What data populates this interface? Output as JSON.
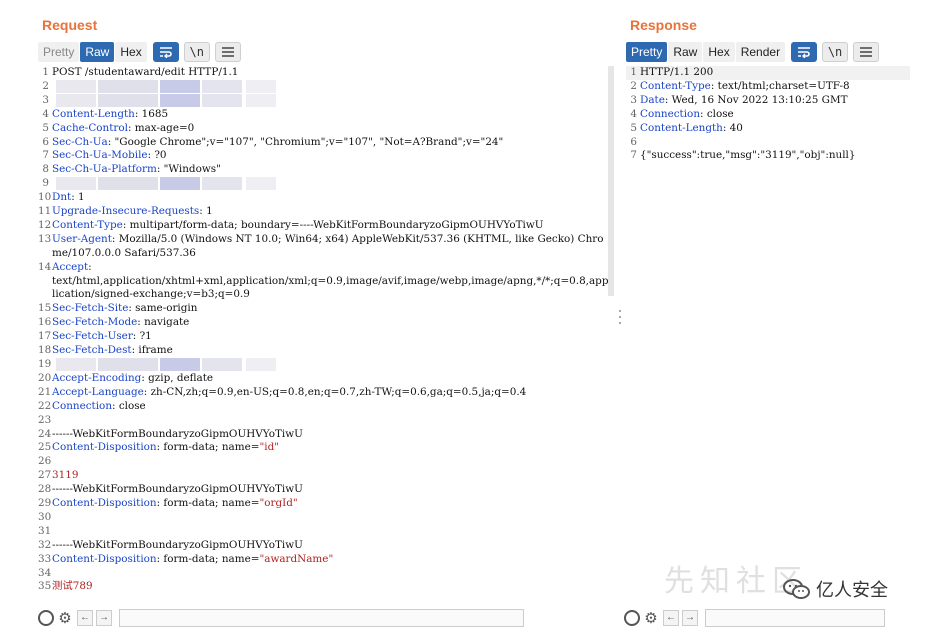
{
  "request": {
    "title": "Request",
    "tabs": [
      "Pretty",
      "Raw",
      "Hex"
    ],
    "newline_label": "\\n",
    "lines": [
      {
        "n": "1",
        "segs": [
          {
            "t": "POST /studentaward/edit HTTP/1.1",
            "c": "hv"
          }
        ]
      },
      {
        "n": "2",
        "segs": [],
        "blur": true
      },
      {
        "n": "3",
        "segs": [],
        "blur": true
      },
      {
        "n": "4",
        "segs": [
          {
            "t": "Content-Length",
            "c": "hk"
          },
          {
            "t": ": 1685",
            "c": "hv"
          }
        ]
      },
      {
        "n": "5",
        "segs": [
          {
            "t": "Cache-Control",
            "c": "hk"
          },
          {
            "t": ": max-age=0",
            "c": "hv"
          }
        ]
      },
      {
        "n": "6",
        "segs": [
          {
            "t": "Sec-Ch-Ua",
            "c": "hk"
          },
          {
            "t": ": \"Google Chrome\";v=\"107\", \"Chromium\";v=\"107\", \"Not=A?Brand\";v=\"24\"",
            "c": "hv"
          }
        ]
      },
      {
        "n": "7",
        "segs": [
          {
            "t": "Sec-Ch-Ua-Mobile",
            "c": "hk"
          },
          {
            "t": ": ?0",
            "c": "hv"
          }
        ]
      },
      {
        "n": "8",
        "segs": [
          {
            "t": "Sec-Ch-Ua-Platform",
            "c": "hk"
          },
          {
            "t": ": \"Windows\"",
            "c": "hv"
          }
        ]
      },
      {
        "n": "9",
        "segs": [],
        "blur": true
      },
      {
        "n": "10",
        "segs": [
          {
            "t": "Dnt",
            "c": "hk"
          },
          {
            "t": ": 1",
            "c": "hv"
          }
        ]
      },
      {
        "n": "11",
        "segs": [
          {
            "t": "Upgrade-Insecure-Requests",
            "c": "hk"
          },
          {
            "t": ": 1",
            "c": "hv"
          }
        ]
      },
      {
        "n": "12",
        "segs": [
          {
            "t": "Content-Type",
            "c": "hk"
          },
          {
            "t": ": multipart/form-data; boundary=----WebKitFormBoundaryzoGipmOUHVYoTiwU",
            "c": "hv"
          }
        ]
      },
      {
        "n": "13",
        "wrap": true,
        "segs": [
          {
            "t": "User-Agent",
            "c": "hk"
          },
          {
            "t": ": Mozilla/5.0 (Windows NT 10.0; Win64; x64) AppleWebKit/537.36 (KHTML, like Gecko) Chrome/107.0.0.0 Safari/537.36",
            "c": "hv"
          }
        ]
      },
      {
        "n": "14",
        "wrap": true,
        "segs": [
          {
            "t": "Accept",
            "c": "hk"
          },
          {
            "t": ":\ntext/html,application/xhtml+xml,application/xml;q=0.9,image/avif,image/webp,image/apng,*/*;q=0.8,application/signed-exchange;v=b3;q=0.9",
            "c": "hv"
          }
        ]
      },
      {
        "n": "15",
        "segs": [
          {
            "t": "Sec-Fetch-Site",
            "c": "hk"
          },
          {
            "t": ": same-origin",
            "c": "hv"
          }
        ]
      },
      {
        "n": "16",
        "segs": [
          {
            "t": "Sec-Fetch-Mode",
            "c": "hk"
          },
          {
            "t": ": navigate",
            "c": "hv"
          }
        ]
      },
      {
        "n": "17",
        "segs": [
          {
            "t": "Sec-Fetch-User",
            "c": "hk"
          },
          {
            "t": ": ?1",
            "c": "hv"
          }
        ]
      },
      {
        "n": "18",
        "segs": [
          {
            "t": "Sec-Fetch-Dest",
            "c": "hk"
          },
          {
            "t": ": iframe",
            "c": "hv"
          }
        ]
      },
      {
        "n": "19",
        "segs": [],
        "blur": true
      },
      {
        "n": "20",
        "segs": [
          {
            "t": "Accept-Encoding",
            "c": "hk"
          },
          {
            "t": ": gzip, deflate",
            "c": "hv"
          }
        ]
      },
      {
        "n": "21",
        "segs": [
          {
            "t": "Accept-Language",
            "c": "hk"
          },
          {
            "t": ": zh-CN,zh;q=0.9,en-US;q=0.8,en;q=0.7,zh-TW;q=0.6,ga;q=0.5,ja;q=0.4",
            "c": "hv"
          }
        ]
      },
      {
        "n": "22",
        "segs": [
          {
            "t": "Connection",
            "c": "hk"
          },
          {
            "t": ": close",
            "c": "hv"
          }
        ]
      },
      {
        "n": "23",
        "segs": []
      },
      {
        "n": "24",
        "segs": [
          {
            "t": "------WebKitFormBoundaryzoGipmOUHVYoTiwU",
            "c": "hv"
          }
        ]
      },
      {
        "n": "25",
        "segs": [
          {
            "t": "Content-Disposition",
            "c": "hk"
          },
          {
            "t": ": form-data; name=",
            "c": "hv"
          },
          {
            "t": "\"id\"",
            "c": "str"
          }
        ]
      },
      {
        "n": "26",
        "segs": []
      },
      {
        "n": "27",
        "segs": [
          {
            "t": "3119",
            "c": "str"
          }
        ]
      },
      {
        "n": "28",
        "segs": [
          {
            "t": "------WebKitFormBoundaryzoGipmOUHVYoTiwU",
            "c": "hv"
          }
        ]
      },
      {
        "n": "29",
        "segs": [
          {
            "t": "Content-Disposition",
            "c": "hk"
          },
          {
            "t": ": form-data; name=",
            "c": "hv"
          },
          {
            "t": "\"orgId\"",
            "c": "str"
          }
        ]
      },
      {
        "n": "30",
        "segs": []
      },
      {
        "n": "31",
        "segs": []
      },
      {
        "n": "32",
        "segs": [
          {
            "t": "------WebKitFormBoundaryzoGipmOUHVYoTiwU",
            "c": "hv"
          }
        ]
      },
      {
        "n": "33",
        "segs": [
          {
            "t": "Content-Disposition",
            "c": "hk"
          },
          {
            "t": ": form-data; name=",
            "c": "hv"
          },
          {
            "t": "\"awardName\"",
            "c": "str"
          }
        ]
      },
      {
        "n": "34",
        "segs": []
      },
      {
        "n": "35",
        "segs": [
          {
            "t": "测试789",
            "c": "str"
          }
        ]
      }
    ]
  },
  "response": {
    "title": "Response",
    "tabs": [
      "Pretty",
      "Raw",
      "Hex",
      "Render"
    ],
    "newline_label": "\\n",
    "lines": [
      {
        "n": "1",
        "hl": true,
        "segs": [
          {
            "t": "HTTP/1.1 200",
            "c": "hv"
          }
        ]
      },
      {
        "n": "2",
        "segs": [
          {
            "t": "Content-Type",
            "c": "hk"
          },
          {
            "t": ": text/html;charset=UTF-8",
            "c": "hv"
          }
        ]
      },
      {
        "n": "3",
        "segs": [
          {
            "t": "Date",
            "c": "hk"
          },
          {
            "t": ": Wed, 16 Nov 2022 13:10:25 GMT",
            "c": "hv"
          }
        ]
      },
      {
        "n": "4",
        "segs": [
          {
            "t": "Connection",
            "c": "hk"
          },
          {
            "t": ": close",
            "c": "hv"
          }
        ]
      },
      {
        "n": "5",
        "segs": [
          {
            "t": "Content-Length",
            "c": "hk"
          },
          {
            "t": ": 40",
            "c": "hv"
          }
        ]
      },
      {
        "n": "6",
        "segs": []
      },
      {
        "n": "7",
        "segs": [
          {
            "t": "{\"success\":true,\"msg\":\"3119\",\"obj\":null}",
            "c": "hv"
          }
        ]
      }
    ]
  },
  "watermark": {
    "text": "先知社区",
    "brand": "亿人安全"
  },
  "colors": {
    "accent": "#e8733a",
    "tab_active": "#2e6ab1",
    "header_key": "#1a44c8",
    "string_value": "#b22222"
  }
}
